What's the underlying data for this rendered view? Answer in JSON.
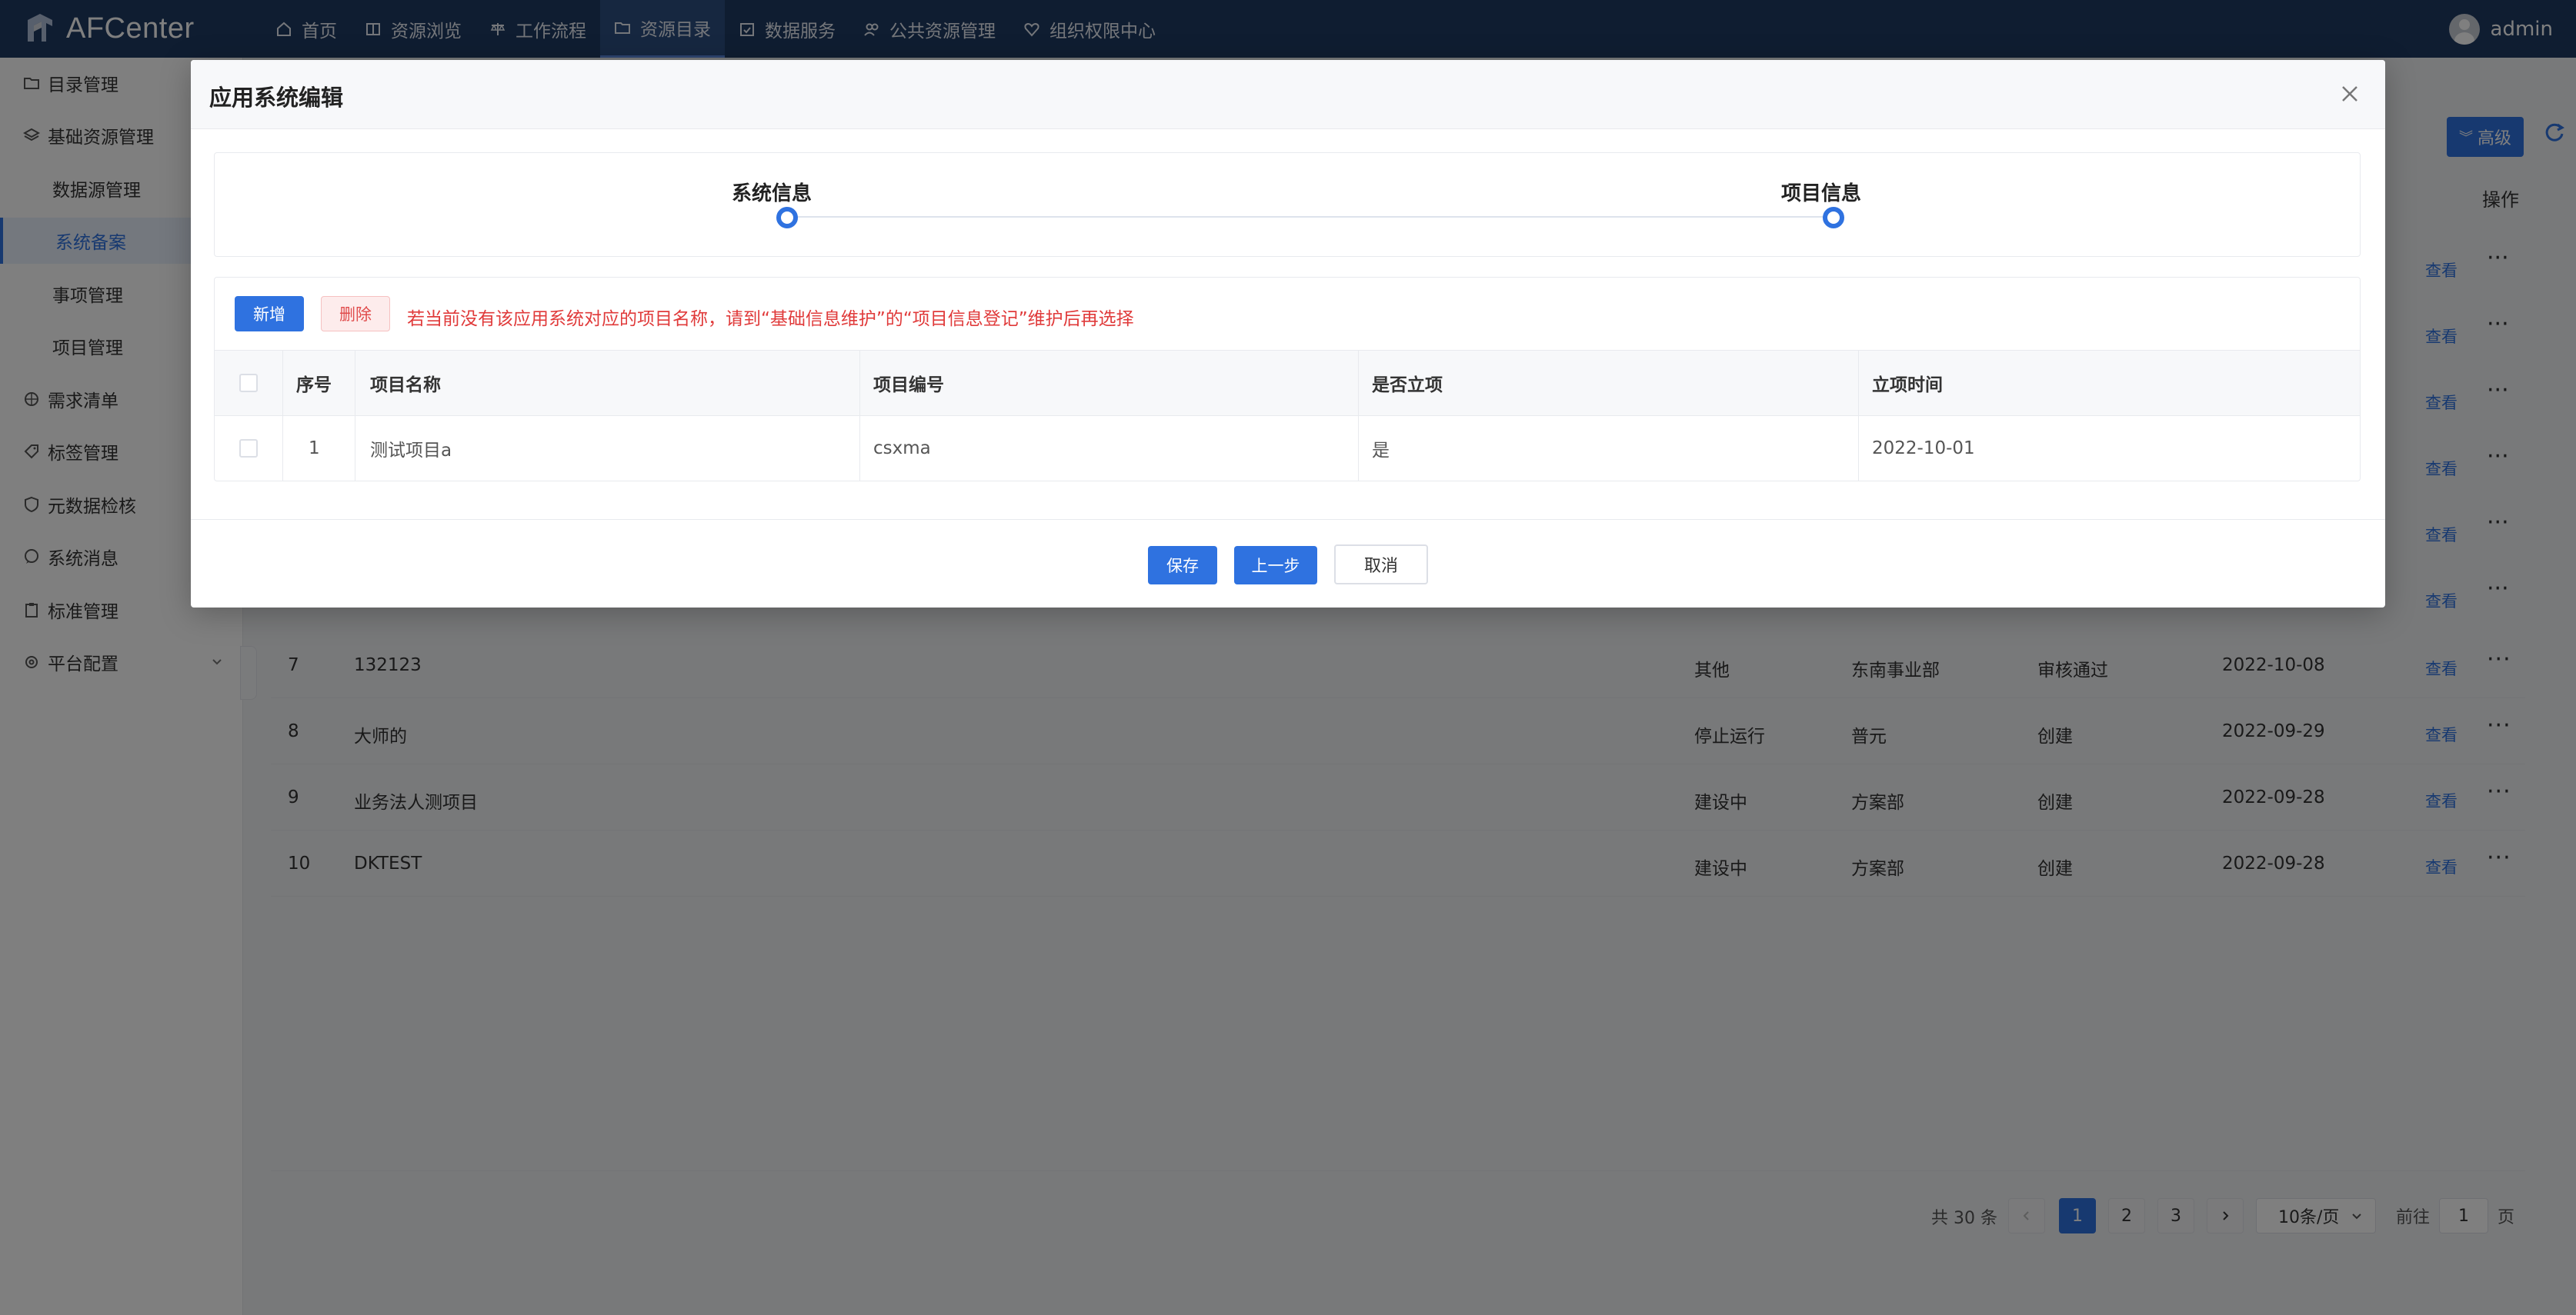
{
  "app": {
    "name": "AFCenter",
    "user": "admin"
  },
  "nav": [
    {
      "label": "首页",
      "icon": "home-icon"
    },
    {
      "label": "资源浏览",
      "icon": "book-icon"
    },
    {
      "label": "工作流程",
      "icon": "scale-icon"
    },
    {
      "label": "资源目录",
      "icon": "folder-icon",
      "active": true
    },
    {
      "label": "数据服务",
      "icon": "calendar-check-icon"
    },
    {
      "label": "公共资源管理",
      "icon": "group-icon"
    },
    {
      "label": "组织权限中心",
      "icon": "heart-icon"
    }
  ],
  "sidebar": [
    {
      "label": "目录管理",
      "icon": "folder-icon"
    },
    {
      "label": "基础资源管理",
      "icon": "layers-icon"
    },
    {
      "label": "数据源管理",
      "sub": true
    },
    {
      "label": "系统备案",
      "sub": true,
      "active": true
    },
    {
      "label": "事项管理",
      "sub": true
    },
    {
      "label": "项目管理",
      "sub": true
    },
    {
      "label": "需求清单",
      "icon": "grid-icon"
    },
    {
      "label": "标签管理",
      "icon": "tag-icon"
    },
    {
      "label": "元数据检核",
      "icon": "shield-icon"
    },
    {
      "label": "系统消息",
      "icon": "chat-icon"
    },
    {
      "label": "标准管理",
      "icon": "clipboard-icon"
    },
    {
      "label": "平台配置",
      "icon": "gear-icon"
    }
  ],
  "main": {
    "advanced_label": "高级",
    "ops_header": "操作",
    "view_label": "查看",
    "rows": [
      {
        "idx": "7",
        "name": "132123",
        "status": "其他",
        "dept": "东南事业部",
        "audit": "审核通过",
        "date": "2022-10-08"
      },
      {
        "idx": "8",
        "name": "大师的",
        "status": "停止运行",
        "dept": "普元",
        "audit": "创建",
        "date": "2022-09-29"
      },
      {
        "idx": "9",
        "name": "业务法人测项目",
        "status": "建设中",
        "dept": "方案部",
        "audit": "创建",
        "date": "2022-09-28"
      },
      {
        "idx": "10",
        "name": "DKTEST",
        "status": "建设中",
        "dept": "方案部",
        "audit": "创建",
        "date": "2022-09-28"
      }
    ],
    "pagination": {
      "total": "共 30 条",
      "pages": [
        "1",
        "2",
        "3"
      ],
      "current": "1",
      "page_size": "10条/页",
      "goto_prefix": "前往",
      "goto_value": "1",
      "goto_suffix": "页"
    }
  },
  "modal": {
    "title": "应用系统编辑",
    "steps": [
      "系统信息",
      "项目信息"
    ],
    "add_label": "新增",
    "delete_label": "删除",
    "hint": "若当前没有该应用系统对应的项目名称，请到“基础信息维护”的“项目信息登记”维护后再选择",
    "columns": [
      "序号",
      "项目名称",
      "项目编号",
      "是否立项",
      "立项时间"
    ],
    "rows": [
      {
        "idx": "1",
        "name": "测试项目a",
        "code": "csxma",
        "approved": "是",
        "date": "2022-10-01"
      }
    ],
    "save_label": "保存",
    "prev_label": "上一步",
    "cancel_label": "取消"
  },
  "colors": {
    "nav_bg": "#1f3a62",
    "primary": "#2f72e0",
    "danger": "#e03a3a"
  }
}
